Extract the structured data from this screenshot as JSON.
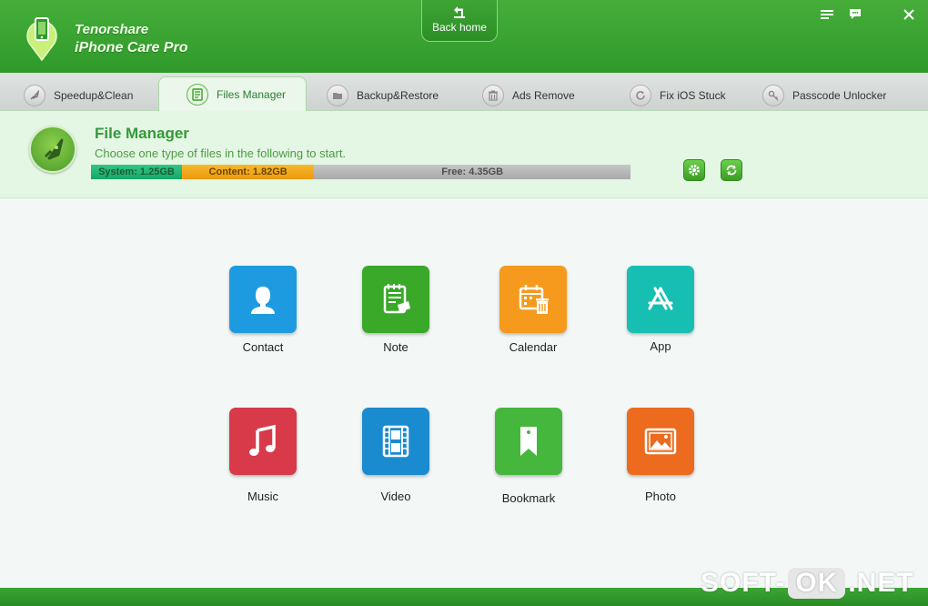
{
  "app": {
    "brand_line1": "Tenorshare",
    "brand_line2": "iPhone Care Pro",
    "back_home_label": "Back home",
    "colors": {
      "brand_green": "#35993a",
      "system": "#14a86a",
      "content": "#eb9a10",
      "free": "#a9a9a9"
    }
  },
  "window_controls": [
    {
      "icon": "menu-icon"
    },
    {
      "icon": "feedback-icon"
    },
    {
      "icon": "close-icon"
    }
  ],
  "tabs": [
    {
      "label": "Speedup&Clean",
      "icon": "rocket-icon"
    },
    {
      "label": "Files Manager",
      "icon": "files-icon",
      "active": true
    },
    {
      "label": "Backup&Restore",
      "icon": "folder-icon"
    },
    {
      "label": "Ads Remove",
      "icon": "trash-icon"
    },
    {
      "label": "Fix iOS Stuck",
      "icon": "refresh-icon"
    },
    {
      "label": "Passcode Unlocker",
      "icon": "key-icon"
    }
  ],
  "panel": {
    "title": "File Manager",
    "subtitle": "Choose one type of files in the following to start.",
    "storage": [
      {
        "label": "System: 1.25GB",
        "gb": 1.25
      },
      {
        "label": "Content: 1.82GB",
        "gb": 1.82
      },
      {
        "label": "Free: 4.35GB",
        "gb": 4.35
      }
    ]
  },
  "file_types": [
    {
      "label": "Contact",
      "icon": "contact-icon",
      "color": "#1e9be0"
    },
    {
      "label": "Note",
      "icon": "note-icon",
      "color": "#3aa829"
    },
    {
      "label": "Calendar",
      "icon": "calendar-icon",
      "color": "#f59a1c"
    },
    {
      "label": "App",
      "icon": "app-store-icon",
      "color": "#17bfb3"
    },
    {
      "label": "Music",
      "icon": "music-icon",
      "color": "#d83a4a"
    },
    {
      "label": "Video",
      "icon": "video-icon",
      "color": "#1b8bd0"
    },
    {
      "label": "Bookmark",
      "icon": "bookmark-icon",
      "color": "#45b73d"
    },
    {
      "label": "Photo",
      "icon": "photo-icon",
      "color": "#ec6b1e"
    }
  ],
  "watermark": {
    "pre": "SOFT-",
    "mid": "OK",
    "post": ".NET"
  }
}
